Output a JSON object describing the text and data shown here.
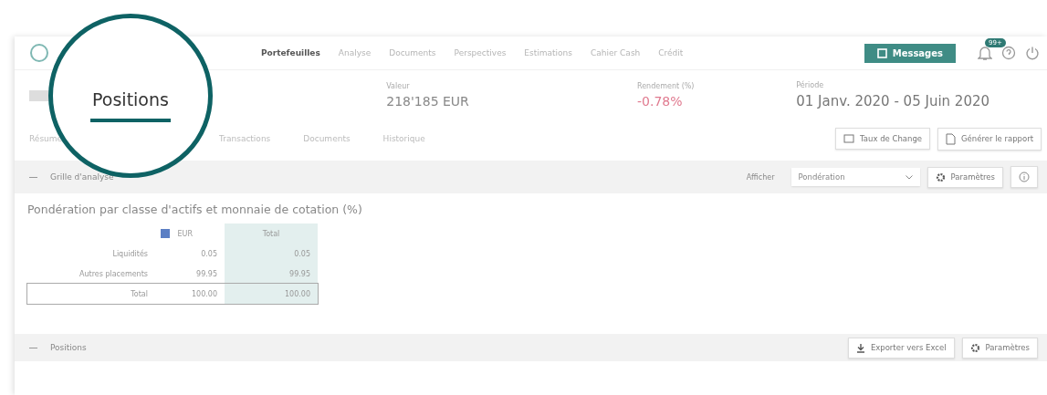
{
  "nav": {
    "items": [
      {
        "label": "Portefeuilles",
        "selected": true
      },
      {
        "label": "Analyse",
        "selected": false
      },
      {
        "label": "Documents",
        "selected": false
      },
      {
        "label": "Perspectives",
        "selected": false
      },
      {
        "label": "Estimations",
        "selected": false
      },
      {
        "label": "Cahier Cash",
        "selected": false
      },
      {
        "label": "Crédit",
        "selected": false
      }
    ],
    "messages_button": "Messages",
    "notification_badge": "99+"
  },
  "summary": [
    {
      "label": "Valeur",
      "value": "218'185 EUR",
      "kind": "amount"
    },
    {
      "label": "Rendement (%)",
      "value": "-0.78%",
      "kind": "negative"
    },
    {
      "label": "Période",
      "value": "01 Janv. 2020 - 05 Juin 2020",
      "kind": "period"
    }
  ],
  "subtabs": [
    {
      "label": "Résumé",
      "selected": false
    },
    {
      "label": "Positions",
      "selected": true
    },
    {
      "label": "Transactions",
      "selected": false
    },
    {
      "label": "Documents",
      "selected": false
    },
    {
      "label": "Historique",
      "selected": false
    }
  ],
  "actions": [
    "Taux de Change",
    "Générer le rapport"
  ],
  "analysis": {
    "title": "Grille d'analyse",
    "display_label": "Afficher",
    "select_value": "Pondération",
    "settings_button": "Paramètres",
    "table_title": "Pondération par classe d'actifs et monnaie de cotation (%)",
    "columns": [
      {
        "label": "EUR",
        "color": "#5b7fc4"
      },
      {
        "label": "Total"
      }
    ],
    "rows": [
      {
        "label": "Liquidités",
        "cells": [
          "0.05",
          "0.05"
        ],
        "total": false
      },
      {
        "label": "Autres placements",
        "cells": [
          "99.95",
          "99.95"
        ],
        "total": false
      },
      {
        "label": "Total",
        "cells": [
          "100.00",
          "100.00"
        ],
        "total": true
      }
    ]
  },
  "positions": {
    "title": "Positions",
    "export_button": "Exporter vers Excel",
    "settings_button": "Paramètres"
  }
}
